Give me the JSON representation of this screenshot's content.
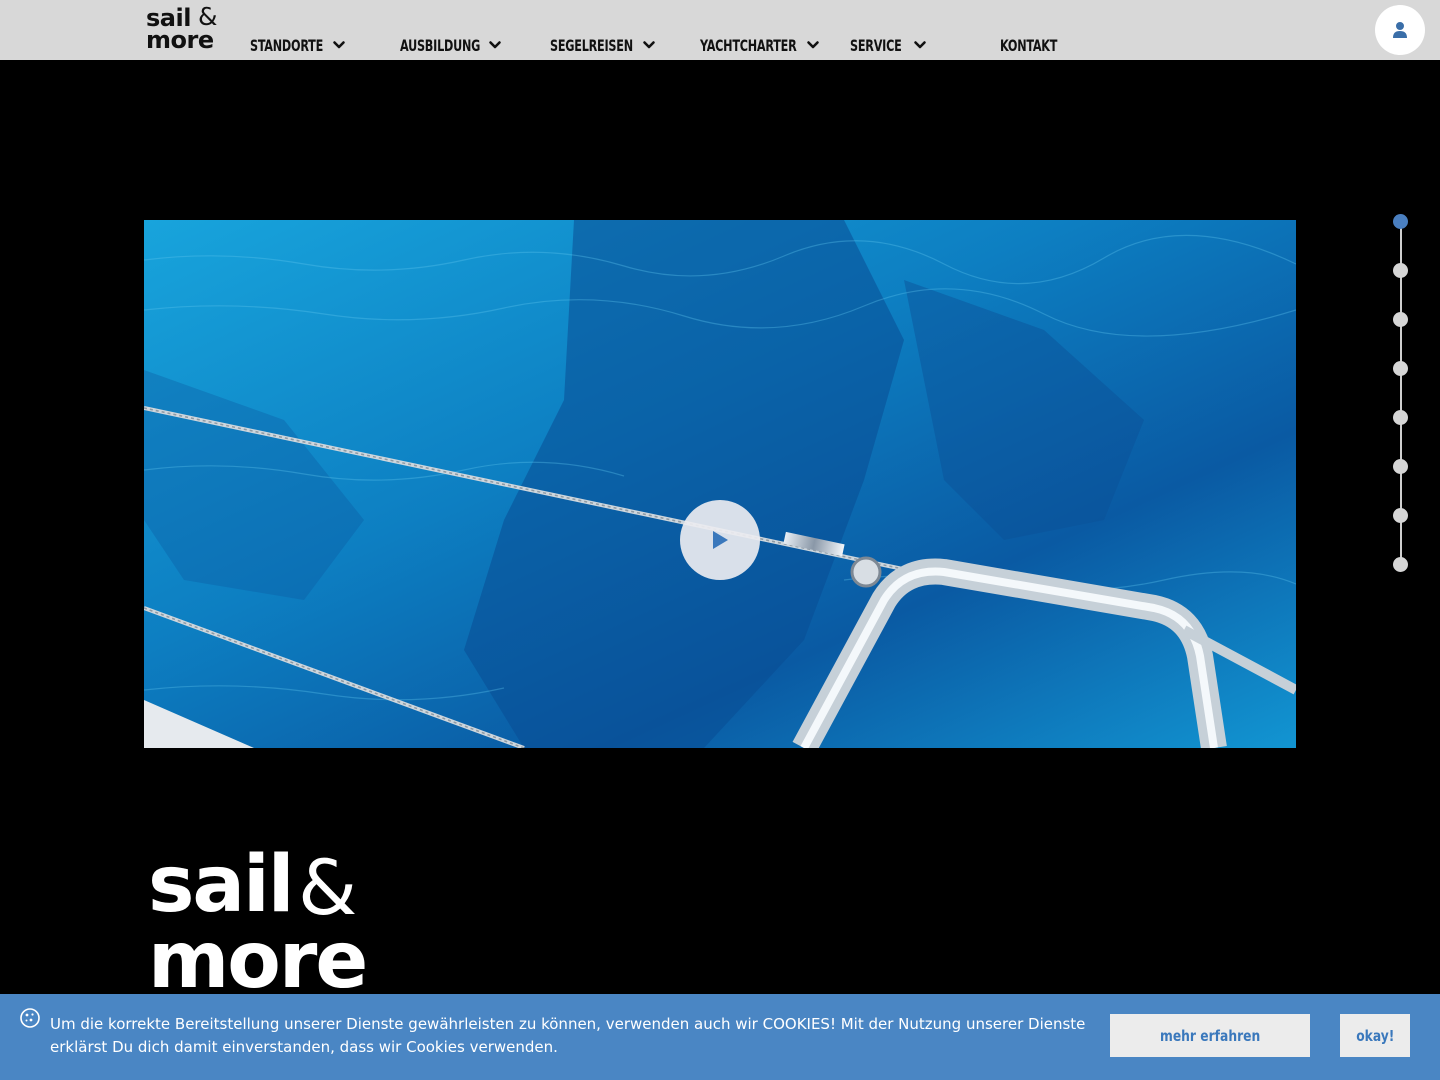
{
  "brand": {
    "line1": "sail",
    "ampersand": "&",
    "line2": "more"
  },
  "nav": {
    "items": [
      {
        "label": "Standorte",
        "has_dropdown": true
      },
      {
        "label": "Ausbildung",
        "has_dropdown": true
      },
      {
        "label": "Segelreisen",
        "has_dropdown": true
      },
      {
        "label": "Yachtcharter",
        "has_dropdown": true
      },
      {
        "label": "Service",
        "has_dropdown": true
      },
      {
        "label": "Kontakt",
        "has_dropdown": false
      }
    ],
    "user_icon": "user-icon"
  },
  "video": {
    "play_icon": "play-icon"
  },
  "section_dots": {
    "count": 8,
    "active_index": 0
  },
  "cookie_banner": {
    "icon": "cookie-icon",
    "text": "Um die korrekte Bereitstellung unserer Dienste gewährleisten zu können, verwenden auch wir COOKIES! Mit der Nutzung unserer Dienste erklärst Du dich damit einverstanden, dass wir Cookies verwenden.",
    "more_label": "mehr erfahren",
    "ok_label": "okay!"
  },
  "colors": {
    "header_bg": "#d8d8d8",
    "accent": "#4a86c4",
    "active_dot": "#4a7fc0",
    "page_bg": "#000000"
  }
}
